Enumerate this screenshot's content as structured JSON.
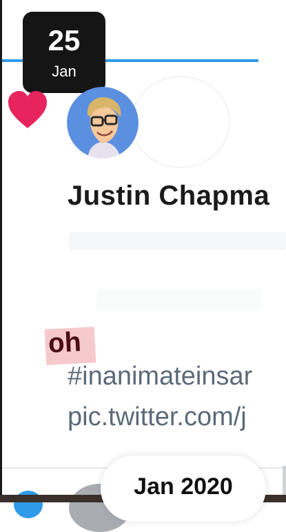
{
  "date_badge": {
    "day": "25",
    "month": "Jan"
  },
  "tweet": {
    "display_name": "Justin Chapma",
    "sticker_text": "oh",
    "hashtag": "#inanimateinsar",
    "link": "pic.twitter.com/j"
  },
  "month_pill": {
    "label": "Jan 2020"
  },
  "colors": {
    "accent": "#2f9be8",
    "heart": "#e8245f",
    "badge_bg": "#151515",
    "sticker_bg": "#f6c9cc",
    "sticker_text": "#4a0d12",
    "secondary_text": "#5c6a78"
  },
  "icons": {
    "heart": "heart-icon",
    "avatar": "cartoon-avatar"
  }
}
